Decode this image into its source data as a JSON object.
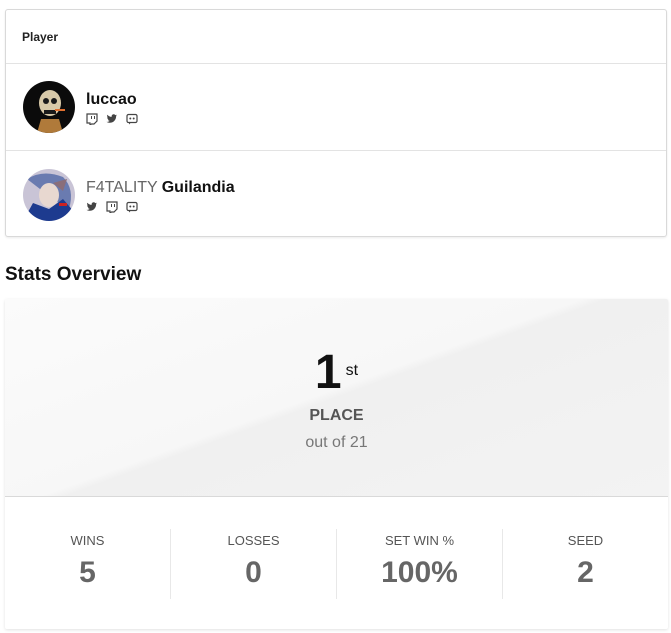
{
  "player_card": {
    "header": "Player",
    "players": [
      {
        "prefix": "",
        "name": "luccao",
        "socials": [
          "twitch-icon",
          "twitter-icon",
          "discord-icon"
        ]
      },
      {
        "prefix": "F4TALITY",
        "name": "Guilandia",
        "socials": [
          "twitter-icon",
          "twitch-icon",
          "discord-icon"
        ]
      }
    ]
  },
  "stats": {
    "title": "Stats Overview",
    "place_number": "1",
    "place_suffix": "st",
    "place_label": "PLACE",
    "out_of": "out of 21",
    "items": [
      {
        "label": "WINS",
        "value": "5"
      },
      {
        "label": "LOSSES",
        "value": "0"
      },
      {
        "label": "SET WIN %",
        "value": "100%"
      },
      {
        "label": "SEED",
        "value": "2"
      }
    ]
  }
}
